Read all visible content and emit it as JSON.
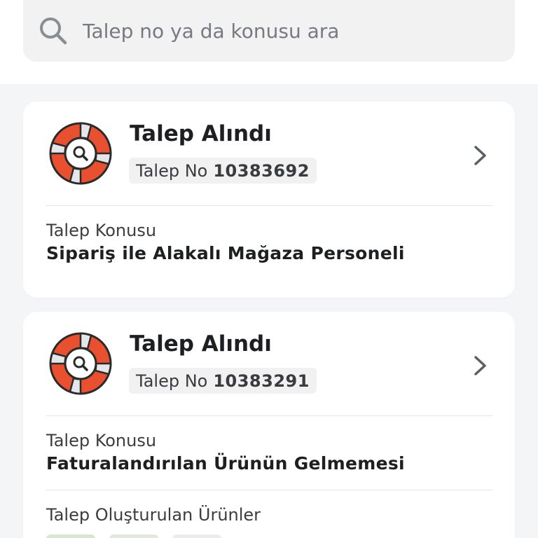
{
  "search": {
    "placeholder": "Talep no ya da konusu ara"
  },
  "colors": {
    "accent": "#e5502e",
    "page_bg": "#f4f5f7",
    "card_bg": "#ffffff"
  },
  "tickets": [
    {
      "status": "Talep Alındı",
      "number_label": "Talep No",
      "number": "10383692",
      "topic_label": "Talep Konusu",
      "topic": "Sipariş ile Alakalı Mağaza Personeli"
    },
    {
      "status": "Talep Alındı",
      "number_label": "Talep No",
      "number": "10383291",
      "topic_label": "Talep Konusu",
      "topic": "Faturalandırılan Ürünün Gelmemesi",
      "products_label": "Talep Oluşturulan Ürünler"
    }
  ]
}
